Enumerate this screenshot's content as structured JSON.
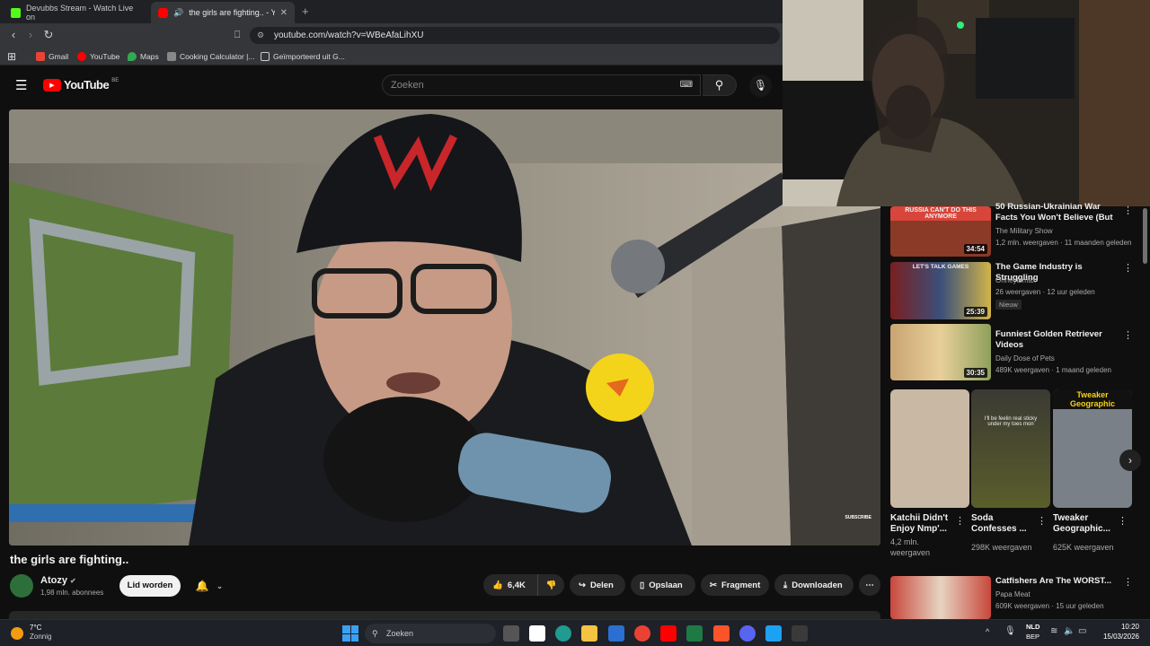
{
  "browser": {
    "tabs": [
      {
        "title": "Devubbs Stream - Watch Live on"
      },
      {
        "title": "the girls are fighting.. - YouTu"
      }
    ],
    "new_tab": "+",
    "url": "youtube.com/watch?v=WBeAfaLihXU",
    "bookmarks": [
      "Gmail",
      "YouTube",
      "Maps",
      "Cooking Calculator |...",
      "Geïmporteerd uit G..."
    ]
  },
  "youtube": {
    "logo": "YouTube",
    "region": "BE",
    "search_placeholder": "Zoeken"
  },
  "video": {
    "title": "the girls are fighting..",
    "channel": "Atozy",
    "subscribers": "1,98 mln. abonnees",
    "join_label": "Lid worden",
    "likes": "6,4K",
    "share_label": "Delen",
    "save_label": "Opslaan",
    "clip_label": "Fragment",
    "download_label": "Downloaden",
    "overlay_text": "SUBSCRIBE"
  },
  "recommendations": [
    {
      "title": "50 Russian-Ukrainian War Facts You Won't Believe (But Are ...",
      "channel": "The Military Show",
      "meta": "1,2 mln. weergaven · 11 maanden geleden",
      "duration": "34:54",
      "thumb_text": "RUSSIA CAN'T DO THIS ANYMORE"
    },
    {
      "title": "The Game Industry is Struggling",
      "channel": "Ohheytsmax",
      "meta": "26 weergaven · 12 uur geleden",
      "duration": "25:39",
      "badge": "Nieuw",
      "thumb_text": "LET'S TALK GAMES"
    },
    {
      "title": "Funniest Golden Retriever Videos",
      "channel": "Daily Dose of Pets",
      "meta": "489K weergaven · 1 maand geleden",
      "duration": "30:35"
    },
    {
      "title": "Catfishers Are The WORST...",
      "channel": "Papa Meat",
      "meta": "609K weergaven · 15 uur geleden"
    }
  ],
  "shorts": [
    {
      "title": "Katchii Didn't Enjoy Nmp'...",
      "views": "4,2 mln. weergaven"
    },
    {
      "title": "Soda Confesses ...",
      "views": "298K weergaven",
      "thumb_text": "I'll be feelin real sticky under my toes mon"
    },
    {
      "title": "Tweaker Geographic...",
      "views": "625K weergaven",
      "thumb_text": "Tweaker Geographic"
    }
  ],
  "taskbar": {
    "temp": "7°C",
    "weather": "Zonnig",
    "search": "Zoeken",
    "lang1": "NLD",
    "lang2": "BEP",
    "time": "10:20",
    "date": "15/03/2026"
  },
  "colors": {
    "youtube_red": "#ff0000",
    "bg": "#0f0f0f",
    "chip": "#272727"
  }
}
